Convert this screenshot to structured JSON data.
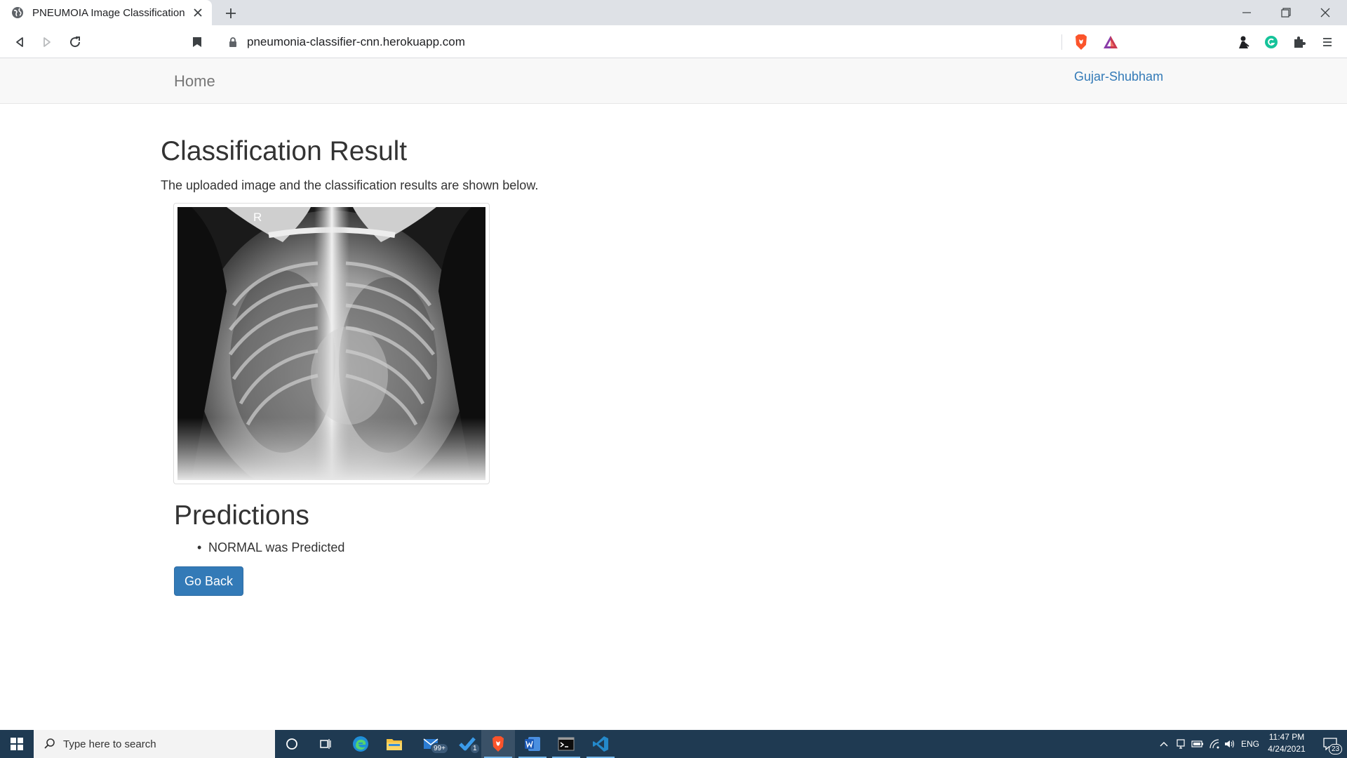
{
  "browser": {
    "tab_title": "PNEUMOIA Image Classification",
    "url": "pneumonia-classifier-cnn.herokuapp.com"
  },
  "navbar": {
    "brand": "Home",
    "user_link": "Gujar-Shubham"
  },
  "content": {
    "heading": "Classification Result",
    "subtitle": "The uploaded image and the classification results are shown below.",
    "image_marker": "R",
    "predictions_title": "Predictions",
    "predictions": [
      "NORMAL was Predicted"
    ],
    "back_button": "Go Back"
  },
  "taskbar": {
    "search_placeholder": "Type here to search",
    "mail_badge": "99+",
    "todo_badge": "1",
    "language": "ENG",
    "time": "11:47 PM",
    "date": "4/24/2021",
    "notifications": "23"
  },
  "colors": {
    "link": "#337ab7",
    "button": "#337ab7",
    "taskbar": "#1f3a52",
    "navbar": "#f8f8f8"
  }
}
